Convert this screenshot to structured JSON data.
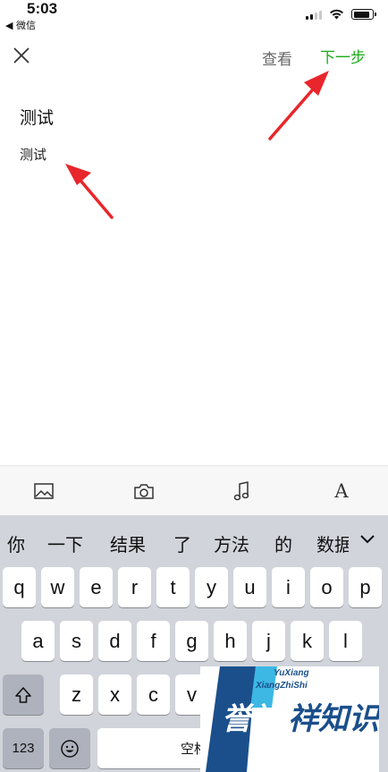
{
  "status": {
    "time": "5:03",
    "back_app": "◀ 微信"
  },
  "nav": {
    "view_label": "查看",
    "next_label": "下一步"
  },
  "content": {
    "title": "测试",
    "body": "测试"
  },
  "keyboard": {
    "candidates": [
      "你",
      "一下",
      "结果",
      "了",
      "方法",
      "的",
      "数据"
    ],
    "row1": [
      "q",
      "w",
      "e",
      "r",
      "t",
      "y",
      "u",
      "i",
      "o",
      "p"
    ],
    "row2": [
      "a",
      "s",
      "d",
      "f",
      "g",
      "h",
      "j",
      "k",
      "l"
    ],
    "row3": [
      "z",
      "x",
      "c",
      "v"
    ],
    "num_label": "123",
    "space_label": "空格"
  },
  "watermark": {
    "top_line": "YuXiang",
    "second_line": "XiangZhiShi",
    "main_text": "誉祥祥知识"
  },
  "colors": {
    "accent": "#1aad19",
    "arrow": "#e8262b",
    "keyboard_bg": "#d1d4da"
  }
}
